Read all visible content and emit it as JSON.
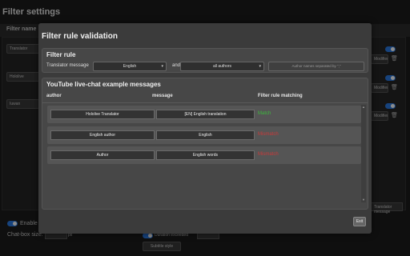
{
  "background": {
    "title": "Filter settings",
    "header_label": "Filter name",
    "left_items": [
      "Translator",
      "Hololive",
      "Iuwan"
    ],
    "action_label": "Modifier",
    "select_value": "Translator message",
    "enable_label": "Enable t",
    "chat_box_size_label": "Chat-box size:",
    "chat_box_size_value": "px",
    "duration_label": "Duration exceeded",
    "subtitle_style_label": "Subtitle style"
  },
  "modal": {
    "title": "Filter rule validation",
    "filter_rule": {
      "title": "Filter rule",
      "label": "Translator message",
      "language": "English",
      "conjunction": "and",
      "authors": "all authors",
      "names_placeholder": "Author names separated by \",\""
    },
    "examples": {
      "title": "YouTube live-chat example messages",
      "columns": [
        "author",
        "message",
        "Filter rule matching"
      ],
      "rows": [
        {
          "author": "Hololive Translator",
          "message": "[EN] English translation",
          "result": "Match"
        },
        {
          "author": "English author",
          "message": "English",
          "result": "Mismatch"
        },
        {
          "author": "Author",
          "message": "English words",
          "result": "Mismatch"
        }
      ]
    },
    "exit_label": "Exit"
  },
  "colors": {
    "match": "#3db83d",
    "mismatch": "#c93a3a",
    "toggle_on": "#2a7be4"
  }
}
